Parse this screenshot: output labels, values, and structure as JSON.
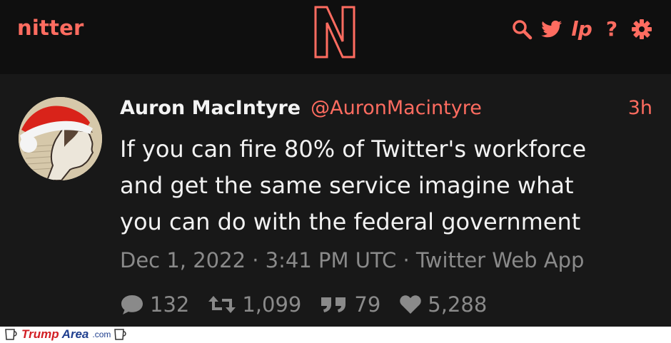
{
  "navbar": {
    "brand": "nitter",
    "logo_letter": "N",
    "icons": [
      "search-icon",
      "twitter-bird-icon",
      "lp-icon",
      "help-icon",
      "settings-icon"
    ],
    "lp_label": "lp",
    "help_label": "?"
  },
  "tweet": {
    "fullname": "Auron MacIntyre",
    "username": "@AuronMacintyre",
    "time_ago": "3h",
    "text": "If you can fire 80% of Twitter's workforce\nand get the same service imagine what\nyou can do with the federal government",
    "date": "Dec 1, 2022 · 3:41 PM UTC · Twitter Web App",
    "stats": {
      "replies": "132",
      "retweets": "1,099",
      "quotes": "79",
      "likes": "5,288"
    }
  },
  "watermark": {
    "part1": "Trump",
    "part2": "Area",
    "part3": ".com"
  },
  "colors": {
    "accent": "#ff6c60",
    "background": "#181818",
    "navbar": "#0f0f0f",
    "text": "#f2f2f2",
    "muted": "#8a8a8a"
  }
}
